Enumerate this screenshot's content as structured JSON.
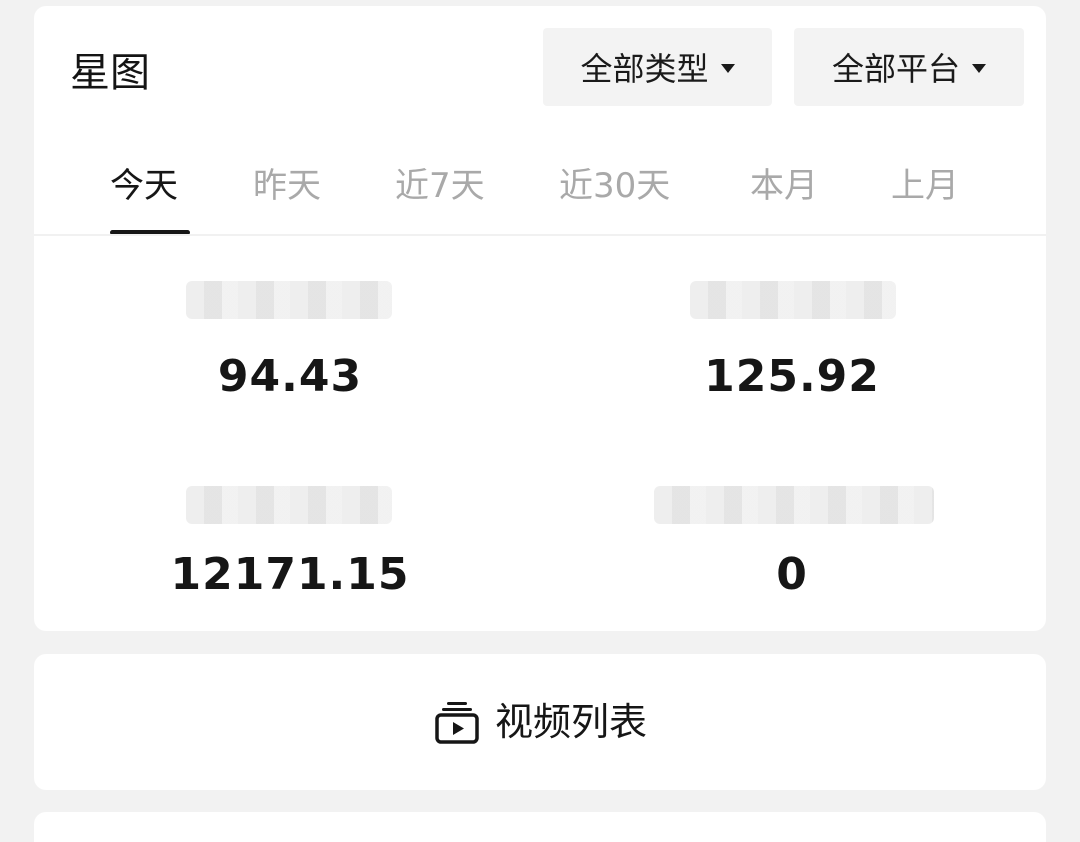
{
  "header": {
    "title": "星图"
  },
  "filters": {
    "type_label": "全部类型",
    "platform_label": "全部平台"
  },
  "tabs": [
    {
      "label": "今天",
      "active": true
    },
    {
      "label": "昨天",
      "active": false
    },
    {
      "label": "近7天",
      "active": false
    },
    {
      "label": "近30天",
      "active": false
    },
    {
      "label": "本月",
      "active": false
    },
    {
      "label": "上月",
      "active": false
    }
  ],
  "metrics": [
    {
      "value": "94.43"
    },
    {
      "value": "125.92"
    },
    {
      "value": "12171.15"
    },
    {
      "value": "0"
    }
  ],
  "video_list": {
    "label": "视频列表",
    "icon": "video-list-icon"
  }
}
